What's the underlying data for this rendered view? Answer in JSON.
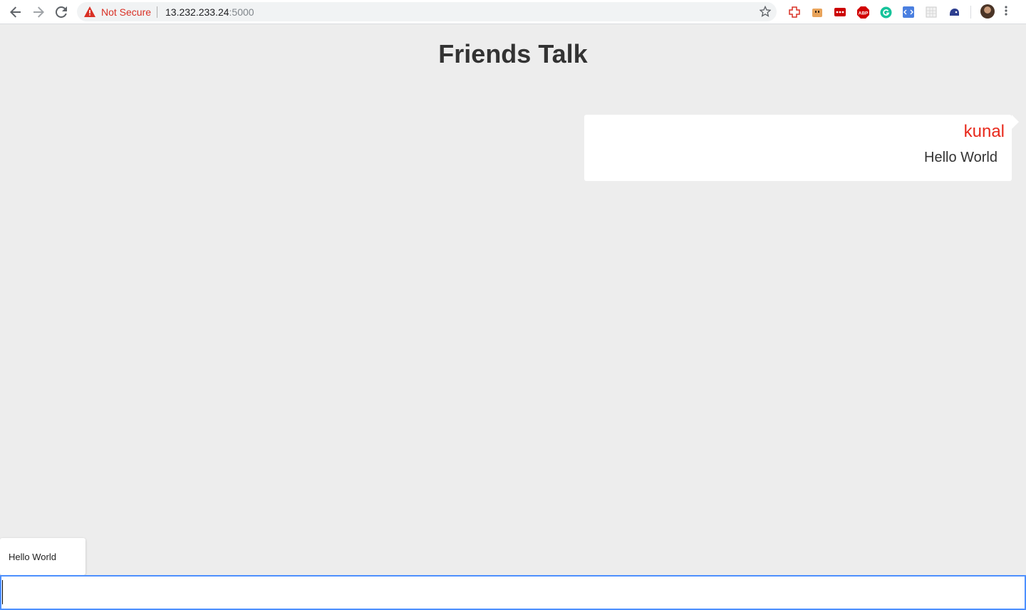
{
  "browser": {
    "security_label": "Not Secure",
    "url_host": "13.232.233.24",
    "url_port": ":5000",
    "icons": [
      "back-icon",
      "forward-icon",
      "reload-icon",
      "warning-icon",
      "bookmark-star-icon",
      "kebab-menu-icon"
    ],
    "extensions": [
      {
        "name": "extension-plus-icon",
        "color": "#d93025"
      },
      {
        "name": "extension-bag-icon",
        "color": "#e8a35a"
      },
      {
        "name": "extension-lastpass-icon",
        "color": "#cc0000"
      },
      {
        "name": "extension-adblock-icon",
        "color": "#d10000",
        "label": "ABP"
      },
      {
        "name": "extension-grammarly-icon",
        "color": "#15c39a"
      },
      {
        "name": "extension-code-icon",
        "color": "#4a7fe0"
      },
      {
        "name": "extension-grid-icon",
        "color": "#c8c8c8"
      },
      {
        "name": "extension-bird-icon",
        "color": "#2d3e8f"
      }
    ]
  },
  "page": {
    "title": "Friends Talk"
  },
  "messages": [
    {
      "user": "kunal",
      "text": "Hello World"
    }
  ],
  "preview": {
    "text": "Hello World"
  },
  "composer": {
    "value": "",
    "placeholder": ""
  },
  "colors": {
    "username": "#e8291c",
    "input_focus": "#4d90fe",
    "background": "#ededed"
  }
}
